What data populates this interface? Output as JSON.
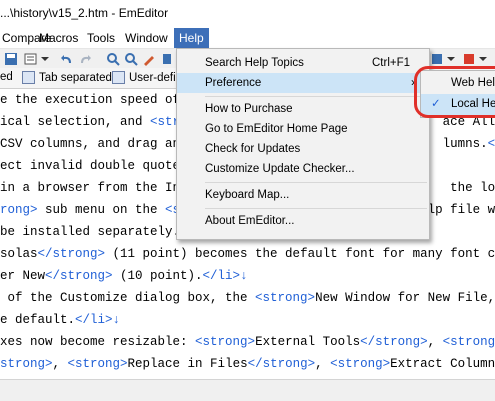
{
  "window": {
    "title": "...\\history\\v15_2.htm - EmEditor"
  },
  "menubar": {
    "items": [
      "Compare",
      "Macros",
      "Tools",
      "Window",
      "Help"
    ]
  },
  "tabs": [
    "ed",
    "Tab separated",
    "User-defi"
  ],
  "help_menu": {
    "items": [
      {
        "label": "Search Help Topics",
        "shortcut": "Ctrl+F1"
      },
      {
        "label": "Preference",
        "arrow": "›"
      },
      {
        "label": "How to Purchase"
      },
      {
        "label": "Go to EmEditor Home Page"
      },
      {
        "label": "Check for Updates"
      },
      {
        "label": "Customize Update Checker..."
      },
      {
        "label": "Keyboard Map..."
      },
      {
        "label": "About EmEditor..."
      }
    ]
  },
  "preference_submenu": {
    "items": [
      {
        "label": "Web Help",
        "checked": false
      },
      {
        "label": "Local Help",
        "checked": true
      }
    ],
    "check_glyph": "✓"
  },
  "editor": {
    "lines": [
      [
        [
          "",
          "e the execution speed of "
        ],
        [
          "tag",
          "<str"
        ],
        [
          "",
          "                                  "
        ],
        [
          "",
          "cting a co"
        ]
      ],
      [
        [
          "",
          "ical selection, and "
        ],
        [
          "tag",
          "<stro"
        ],
        [
          "",
          "                                  "
        ],
        [
          "",
          "ace All"
        ],
        [
          "tag",
          "</s"
        ]
      ],
      [
        [
          "",
          "CSV columns, and drag and"
        ],
        [
          "",
          "                                  "
        ],
        [
          "",
          "lumns."
        ],
        [
          "tag",
          "</li"
        ]
      ],
      [
        [
          "",
          "ect invalid double quotes"
        ]
      ],
      [
        [
          "",
          "in a browser from the Int"
        ],
        [
          "",
          "                                  "
        ],
        [
          "",
          " the local"
        ]
      ],
      [
        [
          "tag",
          "rong>"
        ],
        [
          "",
          " sub menu on the "
        ],
        [
          "tag",
          "<strong>"
        ],
        [
          "",
          "Help"
        ],
        [
          "tag",
          "</strong>"
        ],
        [
          "",
          " menu). The Help file will"
        ]
      ],
      [
        [
          "",
          "be installed separately."
        ],
        [
          "tag",
          "</li>"
        ],
        [
          "rtn",
          "↓"
        ]
      ],
      [
        [
          "",
          "solas"
        ],
        [
          "tag",
          "</strong>"
        ],
        [
          "",
          " (11 point) becomes the default font for many font categ"
        ]
      ],
      [
        [
          "",
          "er New"
        ],
        [
          "tag",
          "</strong>"
        ],
        [
          "",
          " (10 point)."
        ],
        [
          "tag",
          "</li>"
        ],
        [
          "rtn",
          "↓"
        ]
      ],
      [
        [
          "",
          " of the Customize dialog box, the "
        ],
        [
          "tag",
          "<strong>"
        ],
        [
          "",
          "New Window for New File, othe"
        ]
      ],
      [
        [
          "",
          "e default."
        ],
        [
          "tag",
          "</li>"
        ],
        [
          "rtn",
          "↓"
        ]
      ],
      [
        [
          "",
          "xes now become resizable: "
        ],
        [
          "tag",
          "<strong>"
        ],
        [
          "",
          "External Tools"
        ],
        [
          "tag",
          "</strong>"
        ],
        [
          "",
          ", "
        ],
        [
          "tag",
          "<strong>"
        ],
        [
          "",
          "Too"
        ]
      ],
      [
        [
          "tag",
          "strong>"
        ],
        [
          "",
          ", "
        ],
        [
          "tag",
          "<strong>"
        ],
        [
          "",
          "Replace in Files"
        ],
        [
          "tag",
          "</strong>"
        ],
        [
          "",
          ", "
        ],
        [
          "tag",
          "<strong>"
        ],
        [
          "",
          "Extract Columns"
        ],
        [
          "tag",
          "</s"
        ]
      ]
    ]
  },
  "colors": {
    "menu_active": "#3d6fb8",
    "highlight": "#cce4f7",
    "tag": "#1f5fd6",
    "callout": "#e0302a"
  }
}
